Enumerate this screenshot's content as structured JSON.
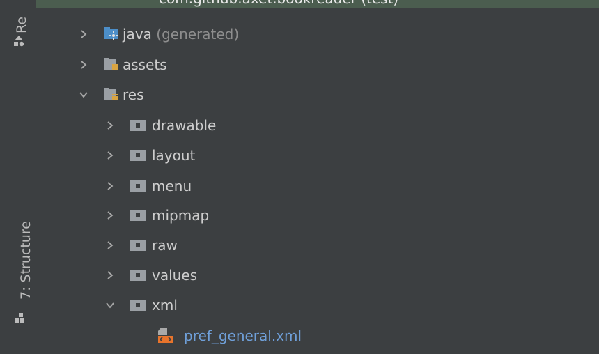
{
  "sidebar": {
    "top_tab": "Re",
    "bottom_tab": "7: Structure"
  },
  "tree": {
    "partial_top_item": "com.github.axet.bookreader (test)",
    "items": [
      {
        "name": "java",
        "suffix": " (generated)",
        "expanded": false,
        "icon": "java-generated-folder-icon"
      },
      {
        "name": "assets",
        "suffix": "",
        "expanded": false,
        "icon": "resource-folder-icon"
      },
      {
        "name": "res",
        "suffix": "",
        "expanded": true,
        "icon": "resource-folder-icon"
      },
      {
        "name": "drawable",
        "suffix": "",
        "expanded": false,
        "icon": "folder-icon"
      },
      {
        "name": "layout",
        "suffix": "",
        "expanded": false,
        "icon": "folder-icon"
      },
      {
        "name": "menu",
        "suffix": "",
        "expanded": false,
        "icon": "folder-icon"
      },
      {
        "name": "mipmap",
        "suffix": "",
        "expanded": false,
        "icon": "folder-icon"
      },
      {
        "name": "raw",
        "suffix": "",
        "expanded": false,
        "icon": "folder-icon"
      },
      {
        "name": "values",
        "suffix": "",
        "expanded": false,
        "icon": "folder-icon"
      },
      {
        "name": "xml",
        "suffix": "",
        "expanded": true,
        "icon": "folder-icon"
      },
      {
        "name": "pref_general.xml",
        "suffix": "",
        "expanded": null,
        "icon": "xml-file-icon"
      }
    ]
  },
  "colors": {
    "background": "#3c3f41",
    "selected_row": "#4b5d4f",
    "text": "#cdcdcd",
    "muted": "#8d8d8d",
    "xml_link": "#6f9fd8"
  }
}
